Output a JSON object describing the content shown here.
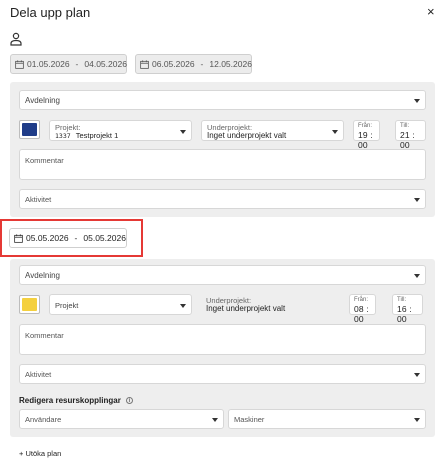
{
  "dialog": {
    "title": "Dela upp plan",
    "close_symbol": "×"
  },
  "ranges": {
    "first": {
      "start": "01.05.2026",
      "end": "04.05.2026"
    },
    "second": {
      "start": "06.05.2026",
      "end": "12.05.2026"
    },
    "third": {
      "start": "05.05.2026",
      "end": "05.05.2026"
    },
    "separator": "-"
  },
  "panel1": {
    "department_placeholder": "Avdelning",
    "color": "#1f3c88",
    "project_label": "Projekt:",
    "project_number": "1337",
    "project_name": "Testprojekt 1",
    "subproject_label": "Underprojekt:",
    "subproject_value": "Inget underprojekt valt",
    "from_label": "Från:",
    "from_value": "19 : 00",
    "to_label": "Till:",
    "to_value": "21 : 00",
    "comment_placeholder": "Kommentar",
    "activity_placeholder": "Aktivitet"
  },
  "panel2": {
    "department_placeholder": "Avdelning",
    "color": "#f4d03f",
    "project_placeholder": "Projekt",
    "subproject_label": "Underprojekt:",
    "subproject_value": "Inget underprojekt valt",
    "from_label": "Från:",
    "from_value": "08 : 00",
    "to_label": "Till:",
    "to_value": "16 : 00",
    "comment_placeholder": "Kommentar",
    "activity_placeholder": "Aktivitet",
    "resource_title": "Redigera resurskopplingar",
    "info_symbol": "i",
    "users_placeholder": "Användare",
    "machines_placeholder": "Maskiner"
  },
  "footer": {
    "extend_label": "+ Utöka plan"
  },
  "colors": {
    "highlight_border": "#e53935",
    "panel_bg": "#eeeeee"
  }
}
